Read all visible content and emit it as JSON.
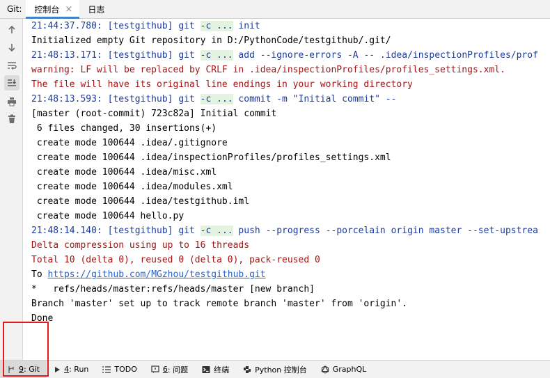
{
  "tabs": {
    "prefix": "Git:",
    "items": [
      {
        "label": "控制台",
        "active": true,
        "closable": true
      },
      {
        "label": "日志",
        "active": false,
        "closable": false
      }
    ]
  },
  "side_toolbar": {
    "buttons": [
      {
        "icon": "arrow-up-icon"
      },
      {
        "icon": "arrow-down-icon"
      },
      {
        "icon": "soft-wrap-icon"
      },
      {
        "icon": "scroll-to-end-icon",
        "toggled": true
      },
      {
        "icon": "print-icon"
      },
      {
        "icon": "trash-icon"
      }
    ]
  },
  "console": {
    "lines": [
      {
        "kind": "cmd",
        "prefix": "21:44:37.780: [testgithub] git ",
        "hl": "-c ...",
        "suffix": " init"
      },
      {
        "kind": "plain",
        "text": "Initialized empty Git repository in D:/PythonCode/testgithub/.git/"
      },
      {
        "kind": "cmd",
        "prefix": "21:48:13.171: [testgithub] git ",
        "hl": "-c ...",
        "suffix": " add --ignore-errors -A -- .idea/inspectionProfiles/prof"
      },
      {
        "kind": "warn",
        "text": "warning: LF will be replaced by CRLF in .idea/inspectionProfiles/profiles_settings.xml."
      },
      {
        "kind": "warn",
        "text": "The file will have its original line endings in your working directory"
      },
      {
        "kind": "cmd",
        "prefix": "21:48:13.593: [testgithub] git ",
        "hl": "-c ...",
        "suffix": " commit -m \"Initial commit\" --"
      },
      {
        "kind": "plain",
        "text": "[master (root-commit) 723c82a] Initial commit"
      },
      {
        "kind": "plain",
        "text": " 6 files changed, 30 insertions(+)"
      },
      {
        "kind": "plain",
        "text": " create mode 100644 .idea/.gitignore"
      },
      {
        "kind": "plain",
        "text": " create mode 100644 .idea/inspectionProfiles/profiles_settings.xml"
      },
      {
        "kind": "plain",
        "text": " create mode 100644 .idea/misc.xml"
      },
      {
        "kind": "plain",
        "text": " create mode 100644 .idea/modules.xml"
      },
      {
        "kind": "plain",
        "text": " create mode 100644 .idea/testgithub.iml"
      },
      {
        "kind": "plain",
        "text": " create mode 100644 hello.py"
      },
      {
        "kind": "cmd",
        "prefix": "21:48:14.140: [testgithub] git ",
        "hl": "-c ...",
        "suffix": " push --progress --porcelain origin master --set-upstrea"
      },
      {
        "kind": "warn",
        "text": "Delta compression using up to 16 threads"
      },
      {
        "kind": "warn",
        "text": "Total 10 (delta 0), reused 0 (delta 0), pack-reused 0"
      },
      {
        "kind": "link",
        "prefix": "To ",
        "link": "https://github.com/MGzhou/testgithub.git"
      },
      {
        "kind": "plain",
        "text": "*   refs/heads/master:refs/heads/master [new branch]"
      },
      {
        "kind": "plain",
        "text": "Branch 'master' set up to track remote branch 'master' from 'origin'."
      },
      {
        "kind": "plain",
        "text": "Done"
      }
    ]
  },
  "statusbar": {
    "items": [
      {
        "icon": "git-branch-icon",
        "mnemonic": "9",
        "label": ": Git",
        "active": true
      },
      {
        "icon": "run-icon",
        "mnemonic": "4",
        "label": ": Run",
        "active": false
      },
      {
        "icon": "todo-icon",
        "mnemonic": "",
        "label": "TODO",
        "active": false
      },
      {
        "icon": "problems-icon",
        "mnemonic": "6",
        "label": ": 问题",
        "active": false
      },
      {
        "icon": "terminal-icon",
        "mnemonic": "",
        "label": "终端",
        "active": false
      },
      {
        "icon": "python-console-icon",
        "mnemonic": "",
        "label": "Python 控制台",
        "active": false
      },
      {
        "icon": "graphql-icon",
        "mnemonic": "",
        "label": "GraphQL",
        "active": false
      }
    ]
  },
  "colors": {
    "accent": "#4083c9",
    "command": "#1c3a9c",
    "warning": "#a31515",
    "link": "#2a62c6",
    "highlight": "#e4f3e0",
    "annotation_frame": "#e01b1b"
  }
}
